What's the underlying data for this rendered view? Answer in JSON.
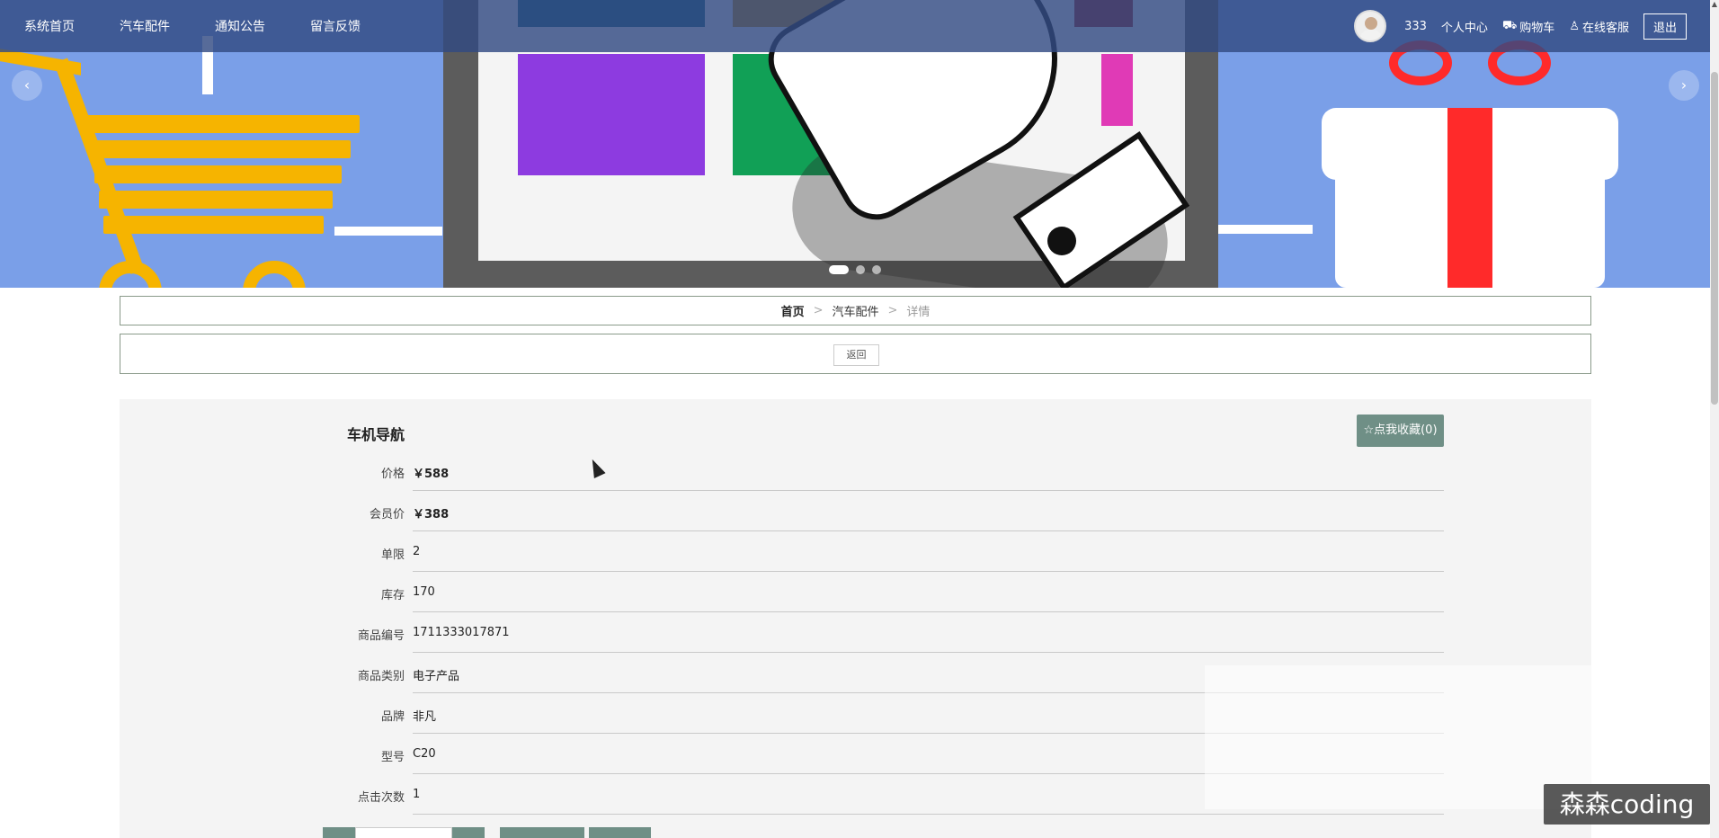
{
  "nav": {
    "items": [
      "系统首页",
      "汽车配件",
      "通知公告",
      "留言反馈"
    ],
    "user_name": "333",
    "personal_center": "个人中心",
    "cart": "购物车",
    "service": "在线客服",
    "logout": "退出"
  },
  "banner": {
    "prev_arrow": "‹",
    "next_arrow": "›",
    "active_slide": 1,
    "slide_count": 3
  },
  "breadcrumb": {
    "home": "首页",
    "category": "汽车配件",
    "current": "详情",
    "separator": ">"
  },
  "back_button": "返回",
  "product": {
    "name": "车机导航",
    "favorite_button": "☆点我收藏(0)",
    "fields": [
      {
        "label": "价格",
        "value": "￥588",
        "bold": true
      },
      {
        "label": "会员价",
        "value": "￥388",
        "bold": true
      },
      {
        "label": "单限",
        "value": "2"
      },
      {
        "label": "库存",
        "value": "170"
      },
      {
        "label": "商品编号",
        "value": "1711333017871"
      },
      {
        "label": "商品类别",
        "value": "电子产品"
      },
      {
        "label": "品牌",
        "value": "非凡"
      },
      {
        "label": "型号",
        "value": "C20"
      },
      {
        "label": "点击次数",
        "value": "1"
      }
    ]
  },
  "watermark": "森森coding",
  "colors": {
    "navbar": "#324b82",
    "accent_button": "#6f8f86",
    "banner_bg": "#7a9fe8"
  }
}
